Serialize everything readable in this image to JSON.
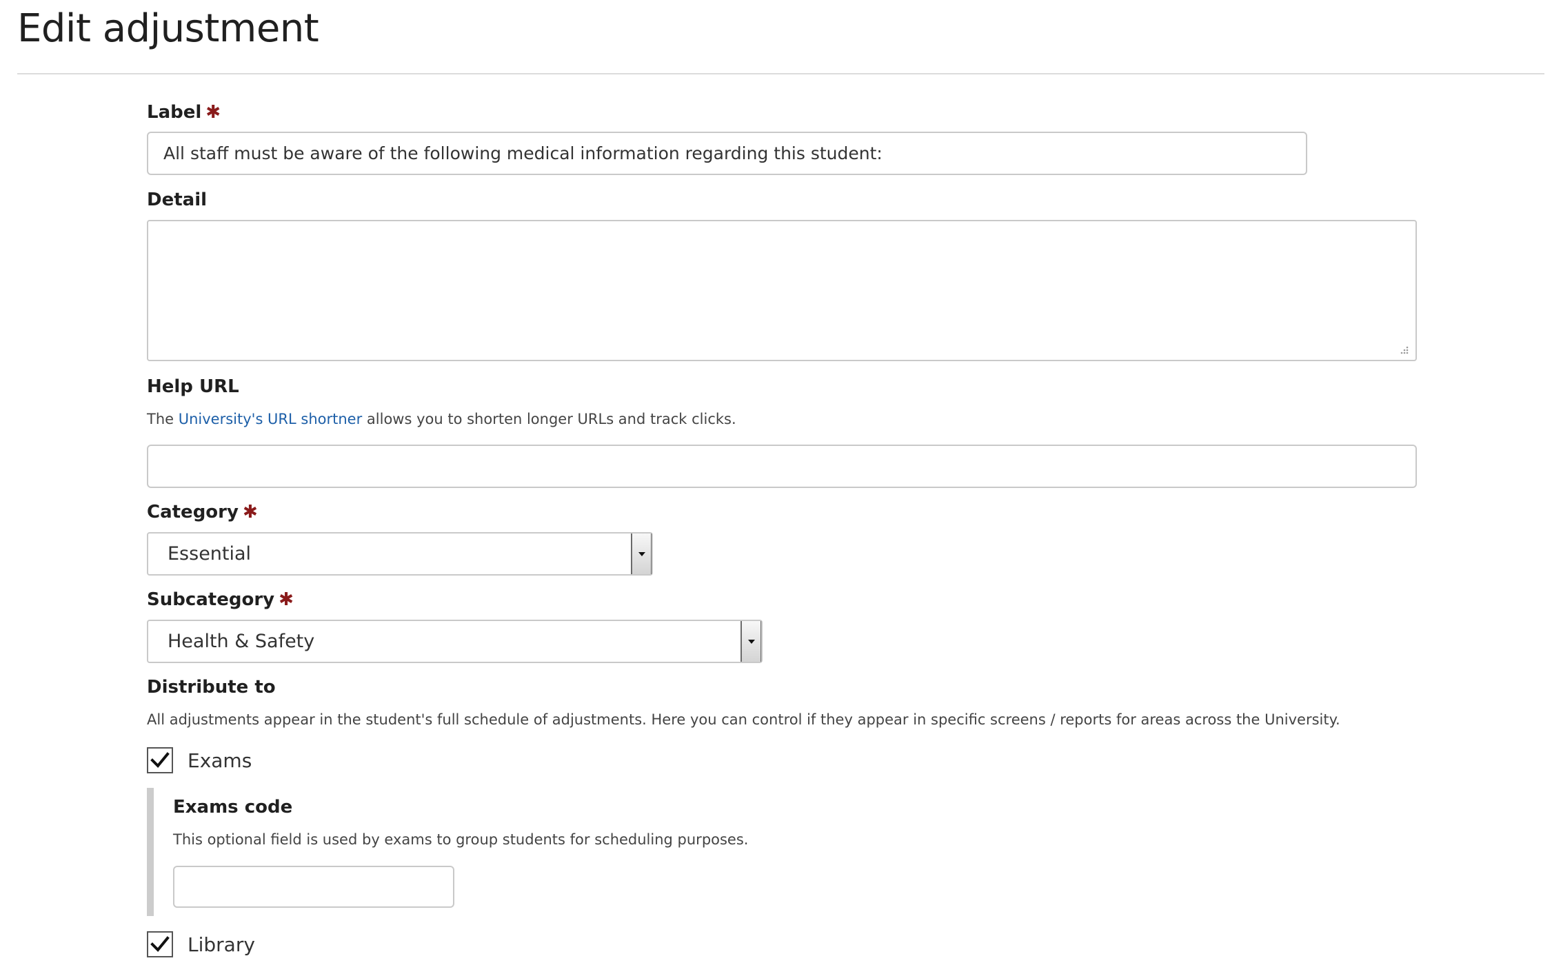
{
  "page": {
    "title": "Edit adjustment"
  },
  "form": {
    "label_field": {
      "label": "Label",
      "required_mark": "✱",
      "value": "All staff must be aware of the following medical information regarding this student:"
    },
    "detail_field": {
      "label": "Detail",
      "value": ""
    },
    "help_url_field": {
      "label": "Help URL",
      "help_prefix": "The ",
      "help_link_text": "University's URL shortner",
      "help_suffix": " allows you to shorten longer URLs and track clicks.",
      "value": ""
    },
    "category_field": {
      "label": "Category",
      "required_mark": "✱",
      "selected": "Essential",
      "icon": "chevron-down-icon"
    },
    "subcategory_field": {
      "label": "Subcategory",
      "required_mark": "✱",
      "selected": "Health & Safety",
      "icon": "chevron-down-icon"
    },
    "distribute_to": {
      "label": "Distribute to",
      "help": "All adjustments appear in the student's full schedule of adjustments. Here you can control if they appear in specific screens / reports for areas across the University.",
      "options": [
        {
          "label": "Exams",
          "checked": true
        },
        {
          "label": "Library",
          "checked": true
        }
      ],
      "exams_code": {
        "label": "Exams code",
        "help": "This optional field is used by exams to group students for scheduling purposes.",
        "value": ""
      }
    }
  },
  "colors": {
    "required_star": "#8a1b1b",
    "link": "#1d5fa8",
    "border": "#c9c9c9",
    "text": "#202020"
  }
}
